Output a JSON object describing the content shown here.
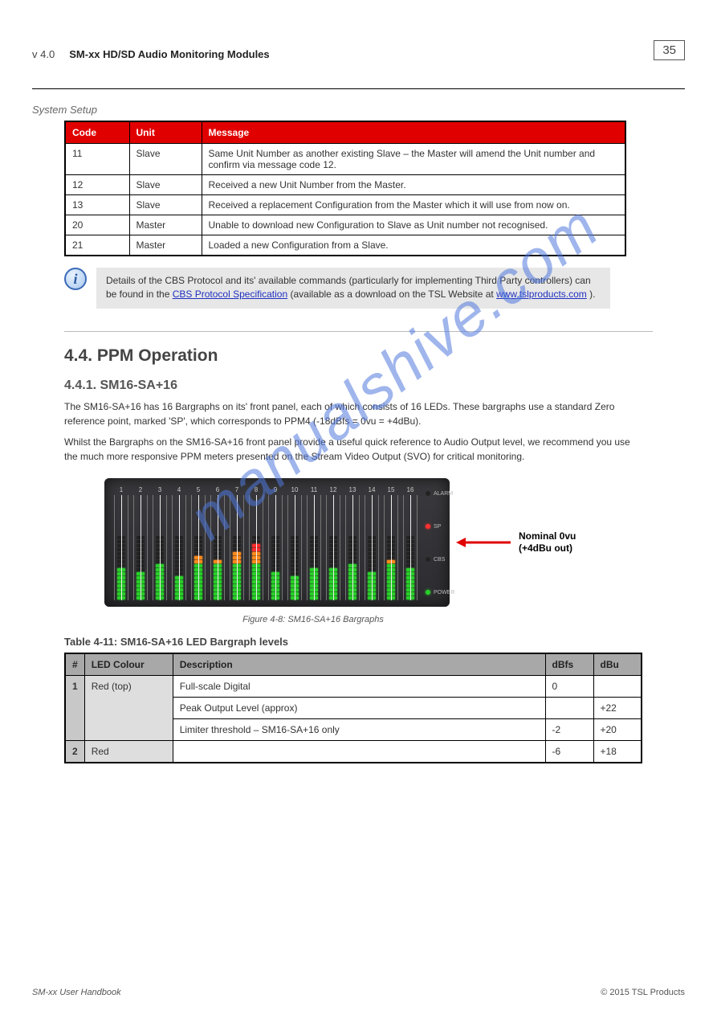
{
  "header": {
    "version": "v 4.0",
    "title": "SM-xx HD/SD Audio Monitoring Modules",
    "page": "35"
  },
  "redtable": {
    "title": "System Setup",
    "headers": [
      "Code",
      "Unit",
      "Message"
    ],
    "rows": [
      [
        "11",
        "Slave",
        "Same Unit Number as another existing Slave – the Master will amend the Unit number and confirm via message code 12."
      ],
      [
        "12",
        "Slave",
        "Received a new Unit Number from the Master."
      ],
      [
        "13",
        "Slave",
        "Received a replacement Configuration from the Master which it will use from now on."
      ],
      [
        "20",
        "Master",
        "Unable to download new Configuration to Slave as Unit number not recognised."
      ],
      [
        "21",
        "Master",
        "Loaded a new Configuration from a Slave."
      ]
    ]
  },
  "infobox": {
    "text_before": "Details of the CBS Protocol and its' available commands (particularly for implementing Third Party controllers) can be found in the ",
    "link1": "CBS Protocol Specification",
    "text_mid1": " (available as a download ",
    "text_mid2": " on the TSL Website at ",
    "link2": "www.tslproducts.com",
    "text_after": " )."
  },
  "section": {
    "num": "4.4.",
    "title": "PPM Operation"
  },
  "ppm": {
    "sub1_num": "4.4.1.",
    "sub1_title": "SM16-SA+16",
    "p1": "The SM16-SA+16 has 16 Bargraphs on its' front panel, each of which consists of 16 LEDs. These bargraphs use a standard Zero reference point, marked 'SP', which corresponds to PPM4 (-18dBfs = 0vu = +4dBu).",
    "p2": "Whilst the Bargraphs on the SM16-SA+16 front panel provide a useful quick reference to Audio Output level, we recommend you use the much more responsive PPM meters presented on the Stream Video Output (SVO) for critical monitoring.",
    "caption": "Figure 4-8: SM16-SA+16 Bargraphs"
  },
  "annotation": {
    "line1": "Nominal 0vu",
    "line2": "(+4dBu out)"
  },
  "status": {
    "labels": [
      "ALARM",
      "SP",
      "CBS",
      "POWER"
    ]
  },
  "greytable": {
    "title": "Table 4-11: SM16-SA+16 LED Bargraph levels",
    "headers": [
      "#",
      "LED Colour",
      "Description",
      "dBfs",
      "dBu"
    ],
    "rows": [
      {
        "num": "",
        "colour": "Red (top)",
        "desc": "Full-scale Digital",
        "dbfs": "0",
        "dbu": ""
      },
      {
        "num": "1",
        "colour": "",
        "desc": "Peak Output Level (approx)",
        "dbfs": "",
        "dbu": "+22"
      },
      {
        "num": "",
        "colour": "",
        "desc": "Limiter threshold – SM16-SA+16 only",
        "dbfs": "-2",
        "dbu": "+20"
      },
      {
        "num": "2",
        "colour": "Red",
        "desc": "",
        "dbfs": "-6",
        "dbu": "+18"
      }
    ]
  },
  "meters": {
    "levels": [
      8,
      7,
      9,
      6,
      11,
      10,
      12,
      14,
      7,
      6,
      8,
      8,
      9,
      7,
      10,
      8
    ]
  },
  "footer": {
    "left": "SM-xx User Handbook",
    "right": "© 2015 TSL Products"
  },
  "watermark": "manualshive.com"
}
